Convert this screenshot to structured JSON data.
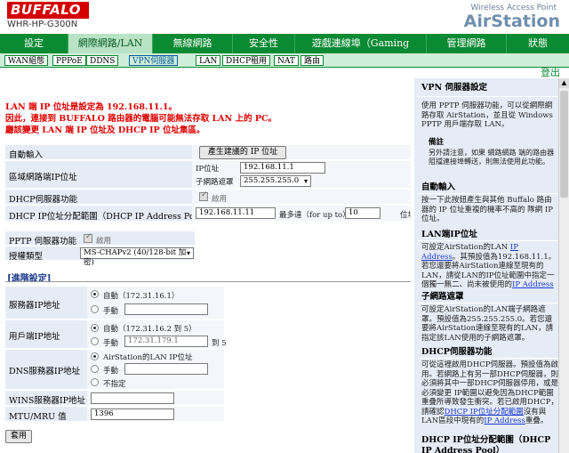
{
  "header": {
    "logo": "BUFFALO",
    "model": "WHR-HP-G300N",
    "product_type": "Wireless Access Point",
    "product_name": "AirStation"
  },
  "main_tabs": [
    {
      "label": "設定",
      "active": false
    },
    {
      "label": "網際網路/LAN",
      "active": true
    },
    {
      "label": "無線網路",
      "active": false
    },
    {
      "label": "安全性",
      "active": false
    },
    {
      "label": "遊戲連線埠（Gaming Ports）",
      "active": false
    },
    {
      "label": "管理網路",
      "active": false
    },
    {
      "label": "狀態",
      "active": false
    }
  ],
  "sub_tabs": [
    {
      "label": "WAN組態",
      "active": false
    },
    {
      "label": "PPPoE",
      "active": false
    },
    {
      "label": "DDNS",
      "active": false
    },
    {
      "label": "VPN伺服器",
      "active": true
    },
    {
      "label": "LAN",
      "active": false
    },
    {
      "label": "DHCP租用",
      "active": false
    },
    {
      "label": "NAT",
      "active": false
    },
    {
      "label": "路由",
      "active": false
    }
  ],
  "logout": "登出",
  "warning": [
    "LAN 端 IP 位址是設定為 192.168.11.1。",
    "因此，連接到 BUFFALO 路由器的電腦可能無法存取 LAN 上的 PC。",
    "廳該變更 LAN 端 IP 位址及 DHCP IP 位址集區。"
  ],
  "form": {
    "auto_input_label": "自動輸入",
    "auto_input_button": "產生建議的 IP 位址",
    "subnet_label": "區域網路端IP位址",
    "ip_caption": "IP位址",
    "ip_value": "192.168.11.1",
    "mask_caption": "子網路遮罩",
    "mask_value": "255.255.255.0",
    "dhcp_server_label": "DHCP伺服器功能",
    "dhcp_server_enable": "啟用",
    "dhcp_range_label": "DHCP IP位址分配範圍（DHCP IP Address Pool）",
    "dhcp_start": "192.168.11.11",
    "dhcp_upto_caption": "最多達（for up to）",
    "dhcp_count": "10",
    "dhcp_unit": "位址",
    "pptp_label": "PPTP 伺服器功能",
    "pptp_enable": "啟用",
    "auth_label": "授權類型",
    "auth_value": "MS-CHAPv2 (40/128-bit 加密)"
  },
  "advanced": {
    "title": "[進階設定]",
    "server_ip_label": "服務器IP地址",
    "server_auto": "自動（172.31.16.1）",
    "server_manual": "手動",
    "client_ip_label": "用戶端IP地址",
    "client_auto": "自動（172.31.16.2 到 5）",
    "client_manual": "手動",
    "client_manual_value": "172.31.179.1",
    "client_to": "到 5",
    "dns_label": "DNS服務器IP地址",
    "dns_lan": "AirStation的LAN IP位址",
    "dns_manual": "手動",
    "dns_none": "不指定",
    "wins_label": "WINS服務器IP地址",
    "mtu_label": "MTU/MRU 值",
    "mtu_value": "1396",
    "apply_button": "套用"
  },
  "help": {
    "vpn_title": "VPN 伺服器設定",
    "vpn_text": "使用 PPTP 伺服器功能，可以從網際網路存取 AirStation，並且從 Windows PPTP 用戶端存取 LAN。",
    "note_title": "備註",
    "note_text": "另外請注意，如果 網路網路 端的路由器阻擋連接埠轉送，則無法使用此功能。",
    "auto_title": "自動輸入",
    "auto_text": "按一下此按鈕產生與其他 Buffalo 路由器的 IP 位址重複的機率不高的 隊網 IP 位址。",
    "lanip_title": "LAN端IP位址",
    "lanip_text_a": "可設定AirStation的LAN ",
    "lanip_link": "IP Address",
    "lanip_text_b": "。其預設值為192.168.11.1。若您還要將AirStation連線至現有的LAN，請從LAN的IP位址範圍中指定一個獨一無二、尚未被使用的",
    "lanip_link2": "IP Address",
    "mask_title": "子網路遮罩",
    "mask_text": "可設定AirStation的LAN端子網路遮罩。預設值為255.255.255.0。若您還要將AirStation連線至現有的LAN，請指定該LAN使用的子網路遮罩。",
    "dhcp_title": "DHCP伺服器功能",
    "dhcp_text_a": "可從這裡啟用DHCP伺服器。預設值為啟用。若網路上有另一部DHCP伺服器，則必須將其中一部DHCP伺服器停用，或是必須變更 IP範圍以避免因為DHCP範圍重疊所導致發生衝突。若已啟用DHCP，請確認",
    "dhcp_link": "DHCP IP位址分配範圍",
    "dhcp_text_b": "沒有與LAN區段中現有的",
    "dhcp_link2": "IP Address",
    "dhcp_text_c": "重疊。",
    "pool_title": "DHCP IP位址分配範圍（DHCP IP Address Pool）"
  }
}
